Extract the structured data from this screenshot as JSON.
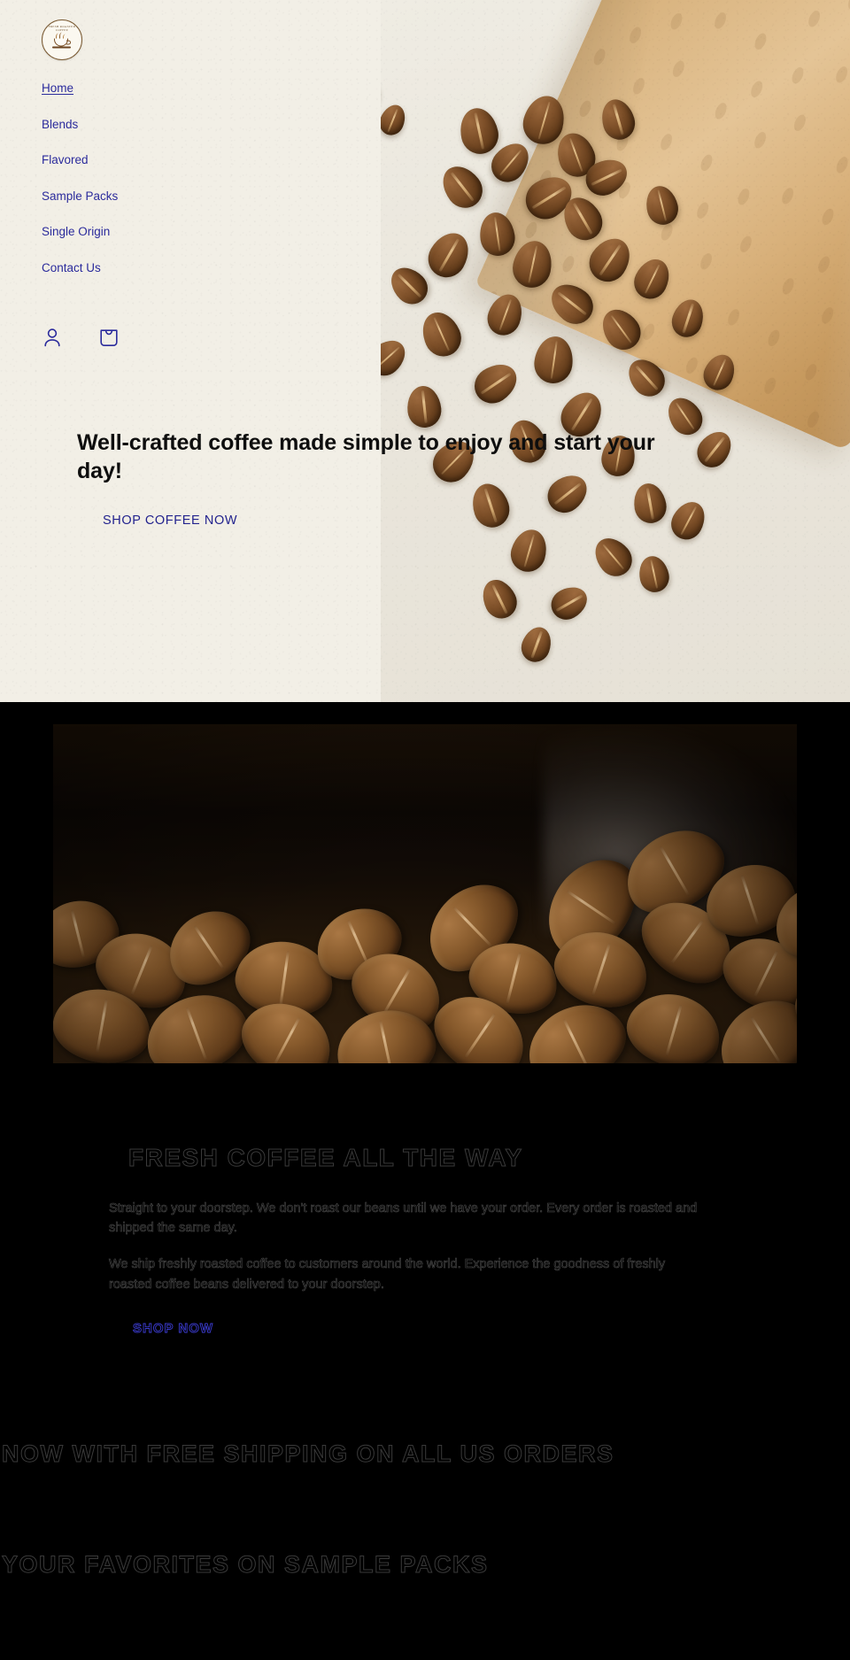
{
  "theme": {
    "hero_bg": "#f2efe6",
    "dark_bg": "#000000",
    "link_blue": "#2b2b9c",
    "cta_blue": "#23238e",
    "outline_gray": "#3a3a3a",
    "kraft": "#d9b480"
  },
  "header": {
    "logo": {
      "icon": "coffee-cup-badge-logo",
      "ring_text": "FRESH ROASTED COFFEE"
    },
    "nav_items": [
      {
        "label": "Home",
        "current": true
      },
      {
        "label": "Blends",
        "current": false
      },
      {
        "label": "Flavored",
        "current": false
      },
      {
        "label": "Sample Packs",
        "current": false
      },
      {
        "label": "Single Origin",
        "current": false
      },
      {
        "label": "Contact Us",
        "current": false
      }
    ],
    "icons": [
      {
        "name": "account-icon",
        "label": "Account"
      },
      {
        "name": "shopping-bag-icon",
        "label": "Cart"
      }
    ]
  },
  "hero": {
    "headline": "Well-crafted coffee made simple to enjoy and start your day!",
    "cta_label": "SHOP COFFEE NOW",
    "image_alt": "coffee-beans-spilling-from-kraft-bag"
  },
  "feature": {
    "image_alt": "roasted-coffee-beans-closeup",
    "title": "FRESH COFFEE ALL THE WAY",
    "paragraphs": [
      "Straight to your doorstep. We don't roast our beans until we have your order. Every order is roasted and shipped the same day.",
      "We ship freshly roasted coffee to customers around the world. Experience the goodness of freshly roasted coffee beans delivered to your doorstep."
    ],
    "cta_label": "SHOP NOW"
  },
  "promos": [
    {
      "title": "NOW WITH FREE SHIPPING ON ALL US ORDERS"
    },
    {
      "title": "YOUR FAVORITES ON SAMPLE PACKS"
    }
  ]
}
